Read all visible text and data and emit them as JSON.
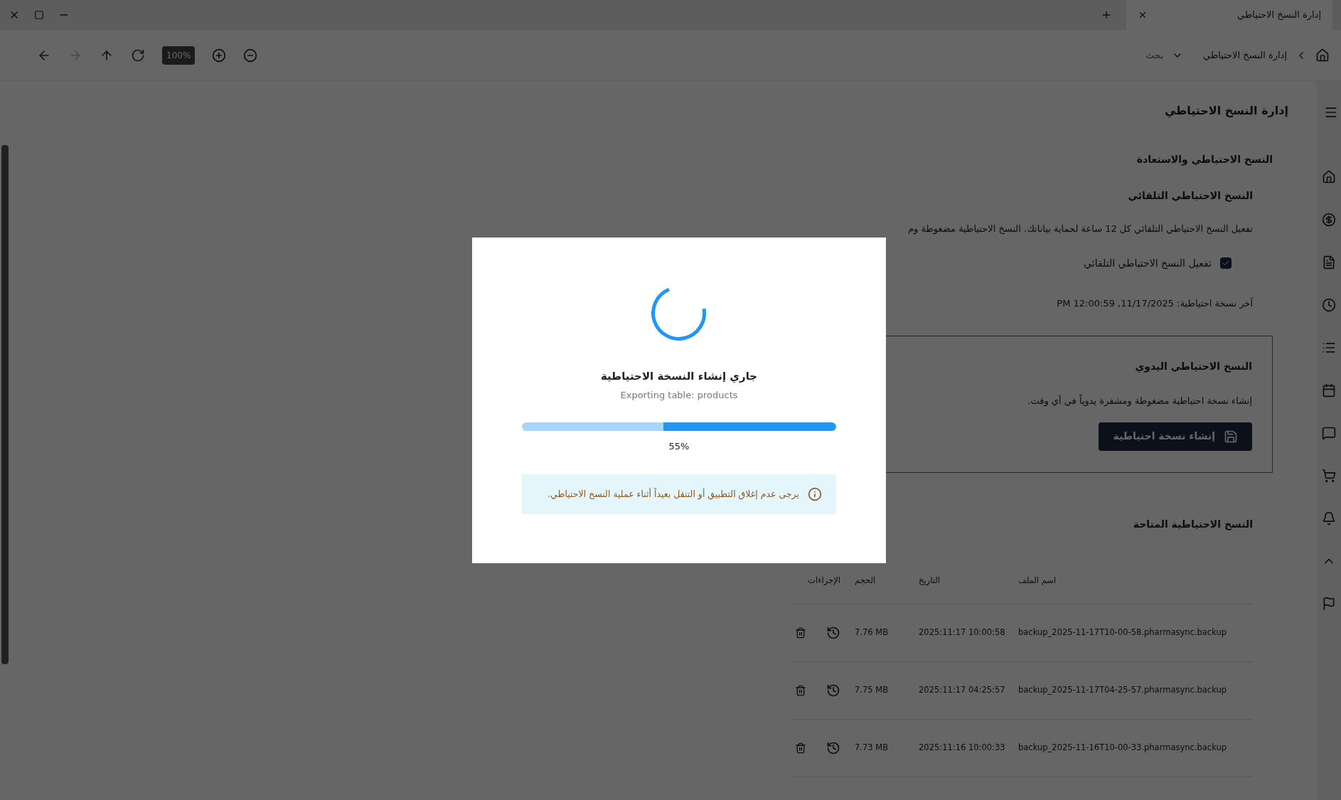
{
  "window": {
    "tab_title": "إدارة النسخ الاحتياطي"
  },
  "toolbar": {
    "nav": [
      {
        "kind": "back",
        "disabled": false
      },
      {
        "kind": "forward",
        "disabled": true
      },
      {
        "kind": "up",
        "disabled": false
      },
      {
        "kind": "refresh",
        "disabled": false
      }
    ],
    "zoom": "100%",
    "breadcrumb": "إدارة النسخ الاحتياطي",
    "search": {
      "placeholder": "بحث"
    }
  },
  "page": {
    "title": "إدارة النسخ الاحتياطي",
    "section_title": "النسخ الاحتياطي والاستعادة",
    "auto_backup": {
      "title": "النسخ الاحتياطي التلقائي",
      "description": "تفعيل النسخ الاحتياطي التلقائي كل 12 ساعة لحماية بياناتك. النسخ الاحتياطية مضغوطة وم",
      "checkbox": {
        "label": "تفعيل النسخ الاحتياطي التلقائي",
        "checked": true
      },
      "last_backup": "آخر نسخة احتياطية: 11/17/2025, 12:00:59 PM"
    },
    "manual_backup": {
      "title": "النسخ الاحتياطي اليدوي",
      "description": "إنشاء نسخة احتياطية مضغوطة ومشفرة يدوياً في أي وقت.",
      "button": "إنشاء نسخة احتياطية"
    },
    "backups": {
      "title": "النسخ الاحتياطية المتاحة",
      "columns": [
        "اسم الملف",
        "التاريخ",
        "الحجم",
        "الإجراءات"
      ],
      "rows": [
        {
          "file": "backup_2025-11-17T10-00-58.pharmasync.backup",
          "date": "2025:11:17 10:00:58",
          "size": "7.76 MB"
        },
        {
          "file": "backup_2025-11-17T04-25-57.pharmasync.backup",
          "date": "2025:11:17 04:25:57",
          "size": "7.75 MB"
        },
        {
          "file": "backup_2025-11-16T10-00-33.pharmasync.backup",
          "date": "2025:11:16 10:00:33",
          "size": "7.73 MB"
        }
      ]
    }
  },
  "dialog": {
    "title": "جاري إنشاء النسخة الاحتياطية",
    "status": "Exporting table: products",
    "progress": {
      "level": 0.55,
      "reading": "55%"
    },
    "notice": "يرجى عدم إغلاق التطبيق أو التنقل بعيداً أثناء عملية النسخ الاحتياطي."
  }
}
